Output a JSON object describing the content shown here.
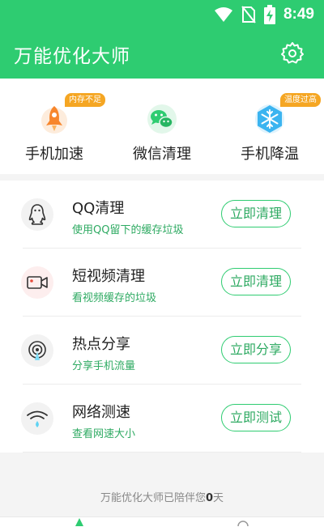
{
  "status": {
    "time": "8:49"
  },
  "header": {
    "title": "万能优化大师"
  },
  "quick_actions": [
    {
      "label": "手机加速",
      "badge": "内存不足",
      "icon": "rocket-icon"
    },
    {
      "label": "微信清理",
      "badge": "",
      "icon": "wechat-icon"
    },
    {
      "label": "手机降温",
      "badge": "温度过高",
      "icon": "snowflake-icon"
    }
  ],
  "items": [
    {
      "title": "QQ清理",
      "subtitle": "使用QQ留下的缓存垃圾",
      "button": "立即清理",
      "icon": "qq-penguin-icon"
    },
    {
      "title": "短视频清理",
      "subtitle": "看视频缓存的垃圾",
      "button": "立即清理",
      "icon": "video-camera-icon"
    },
    {
      "title": "热点分享",
      "subtitle": "分享手机流量",
      "button": "立即分享",
      "icon": "hotspot-icon"
    },
    {
      "title": "网络测速",
      "subtitle": "查看网速大小",
      "button": "立即测试",
      "icon": "wifi-speed-icon"
    }
  ],
  "footer": {
    "prefix": "万能优化大师已陪伴您",
    "days": "0",
    "suffix": "天"
  },
  "colors": {
    "brand": "#2ecc71",
    "badge": "#f5a623",
    "accent_text": "#2eaa62"
  }
}
